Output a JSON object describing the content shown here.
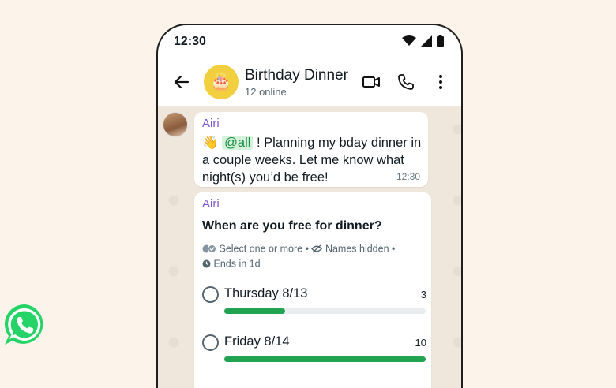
{
  "status_bar": {
    "time": "12:30"
  },
  "header": {
    "title": "Birthday Dinner",
    "subtitle": "12 online",
    "avatar_emoji": "🎂"
  },
  "messages": [
    {
      "sender": "Airi",
      "emoji": "👋",
      "mention": "@all",
      "text": "! Planning my bday dinner in a couple weeks. Let me know what night(s) you’d be free!",
      "time": "12:30"
    }
  ],
  "poll": {
    "sender": "Airi",
    "question": "When are you free for dinner?",
    "meta_select": "Select one or more",
    "meta_names": "Names hidden",
    "meta_sep": "•",
    "meta_ends": "Ends in 1d",
    "options": [
      {
        "label": "Thursday 8/13",
        "count": "3",
        "fraction": 0.3
      },
      {
        "label": "Friday 8/14",
        "count": "10",
        "fraction": 1.0
      }
    ]
  },
  "colors": {
    "accent_green": "#21a352",
    "sender_purple": "#7c55d6",
    "background": "#fcf4ea",
    "logo_green": "#25d366"
  },
  "icons": [
    "back-arrow-icon",
    "video-call-icon",
    "phone-icon",
    "more-vert-icon",
    "wifi-icon",
    "signal-icon",
    "battery-icon",
    "double-check-icon",
    "eye-off-icon",
    "clock-icon",
    "whatsapp-logo-icon"
  ]
}
